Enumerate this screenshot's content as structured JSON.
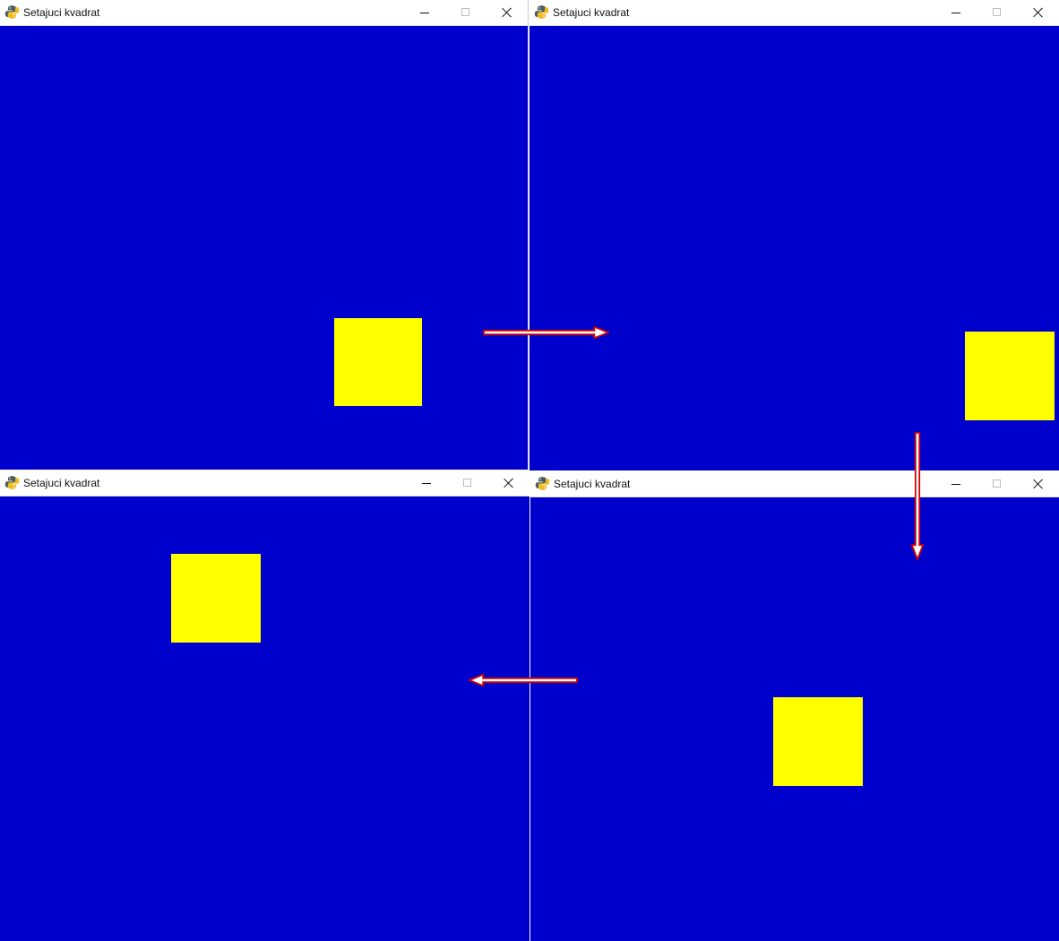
{
  "app": {
    "title": "Setajuci kvadrat",
    "icon_name": "python-app-icon"
  },
  "window_controls": {
    "minimize_icon": "minimize-icon",
    "maximize_icon": "maximize-icon",
    "close_icon": "close-icon"
  },
  "windows": [
    {
      "title": "Setajuci kvadrat",
      "square_color": "yellow"
    },
    {
      "title": "Setajuci kvadrat",
      "square_color": "yellow"
    },
    {
      "title": "Setajuci kvadrat",
      "square_color": "yellow"
    },
    {
      "title": "Setajuci kvadrat",
      "square_color": "yellow"
    }
  ],
  "colors": {
    "canvas_background": "#0000cc",
    "square": "#ffff00",
    "titlebar_background": "#ffffff",
    "arrow_outline": "#d10000",
    "arrow_fill": "#ffffff"
  },
  "annotations": {
    "movement_arrows": [
      "right",
      "down",
      "left"
    ]
  }
}
